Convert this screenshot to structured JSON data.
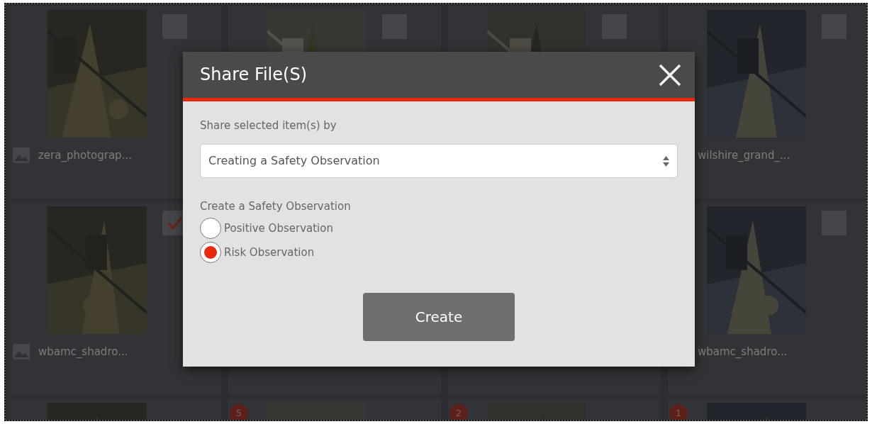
{
  "gallery": {
    "tiles": [
      {
        "kind": "picture",
        "icon": true,
        "caption": "zera_photograp...",
        "checked": false
      },
      {
        "kind": "picture",
        "checked": false
      },
      {
        "kind": "picture",
        "checked": false
      },
      {
        "kind": "picture",
        "caption": "wilshire_grand_...",
        "checked": false
      },
      {
        "kind": "picture",
        "icon": true,
        "caption": "wbamc_shadro...",
        "checked": true
      },
      {
        "kind": "blank"
      },
      {
        "kind": "blank"
      },
      {
        "kind": "picture",
        "caption": "wbamc_shadro...",
        "checked": false
      },
      {
        "kind": "picture"
      },
      {
        "kind": "picture",
        "badge": "5"
      },
      {
        "kind": "picture",
        "badge": "2"
      },
      {
        "kind": "picture",
        "badge": "1"
      }
    ]
  },
  "dialog": {
    "title": "Share File(S)",
    "method_label": "Share selected item(s) by",
    "method_value": "Creating a Safety Observation",
    "group_label": "Create a Safety Observation",
    "options": [
      {
        "label": "Positive Observation",
        "selected": false
      },
      {
        "label": "Risk Observation",
        "selected": true
      }
    ],
    "button": "Create"
  }
}
